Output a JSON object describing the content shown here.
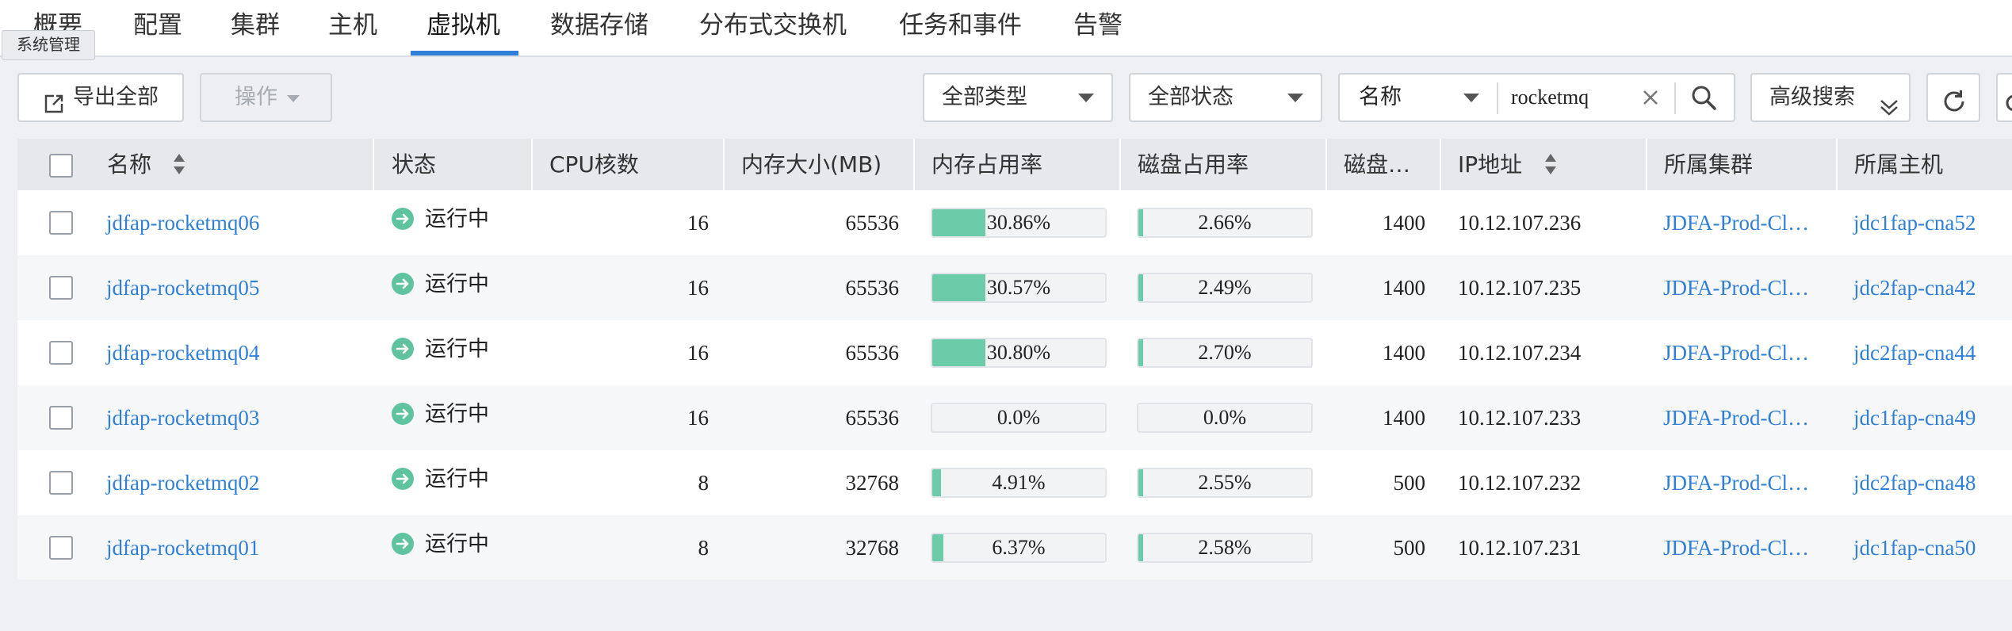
{
  "nav": {
    "items": [
      "概要",
      "配置",
      "集群",
      "主机",
      "虚拟机",
      "数据存储",
      "分布式交换机",
      "任务和事件",
      "告警"
    ],
    "active_index": 4,
    "tooltip": "系统管理"
  },
  "toolbar": {
    "export_label": "导出全部",
    "action_label": "操作",
    "type_filter": "全部类型",
    "status_filter": "全部状态",
    "search_field": "名称",
    "search_value": "rocketmq",
    "advanced_search": "高级搜索"
  },
  "table": {
    "columns": [
      "名称",
      "状态",
      "CPU核数",
      "内存大小(MB)",
      "内存占用率",
      "磁盘占用率",
      "磁盘…",
      "IP地址",
      "所属集群",
      "所属主机"
    ],
    "rows": [
      {
        "name": "jdfap-rocketmq06",
        "status": "运行中",
        "cpu": "16",
        "mem": "65536",
        "mem_usage": "30.86%",
        "mem_usage_value": 30.86,
        "disk_usage": "2.66%",
        "disk_usage_value": 2.66,
        "disk": "1400",
        "ip": "10.12.107.236",
        "cluster": "JDFA-Prod-Cl…",
        "host": "jdc1fap-cna52"
      },
      {
        "name": "jdfap-rocketmq05",
        "status": "运行中",
        "cpu": "16",
        "mem": "65536",
        "mem_usage": "30.57%",
        "mem_usage_value": 30.57,
        "disk_usage": "2.49%",
        "disk_usage_value": 2.49,
        "disk": "1400",
        "ip": "10.12.107.235",
        "cluster": "JDFA-Prod-Cl…",
        "host": "jdc2fap-cna42"
      },
      {
        "name": "jdfap-rocketmq04",
        "status": "运行中",
        "cpu": "16",
        "mem": "65536",
        "mem_usage": "30.80%",
        "mem_usage_value": 30.8,
        "disk_usage": "2.70%",
        "disk_usage_value": 2.7,
        "disk": "1400",
        "ip": "10.12.107.234",
        "cluster": "JDFA-Prod-Cl…",
        "host": "jdc2fap-cna44"
      },
      {
        "name": "jdfap-rocketmq03",
        "status": "运行中",
        "cpu": "16",
        "mem": "65536",
        "mem_usage": "0.0%",
        "mem_usage_value": 0.0,
        "disk_usage": "0.0%",
        "disk_usage_value": 0.0,
        "disk": "1400",
        "ip": "10.12.107.233",
        "cluster": "JDFA-Prod-Cl…",
        "host": "jdc1fap-cna49"
      },
      {
        "name": "jdfap-rocketmq02",
        "status": "运行中",
        "cpu": "8",
        "mem": "32768",
        "mem_usage": "4.91%",
        "mem_usage_value": 4.91,
        "disk_usage": "2.55%",
        "disk_usage_value": 2.55,
        "disk": "500",
        "ip": "10.12.107.232",
        "cluster": "JDFA-Prod-Cl…",
        "host": "jdc2fap-cna48"
      },
      {
        "name": "jdfap-rocketmq01",
        "status": "运行中",
        "cpu": "8",
        "mem": "32768",
        "mem_usage": "6.37%",
        "mem_usage_value": 6.37,
        "disk_usage": "2.58%",
        "disk_usage_value": 2.58,
        "disk": "500",
        "ip": "10.12.107.231",
        "cluster": "JDFA-Prod-Cl…",
        "host": "jdc1fap-cna50"
      }
    ]
  },
  "colors": {
    "accent": "#2f7fd8",
    "status_running": "#5fc3a0",
    "usage_bar": "#6ccba8",
    "header_bg": "#e6e8ec"
  },
  "icons": [
    "export-icon",
    "caret-down-icon",
    "clear-icon",
    "search-icon",
    "double-chevron-down-icon",
    "refresh-icon",
    "sort-icon",
    "running-status-icon"
  ]
}
